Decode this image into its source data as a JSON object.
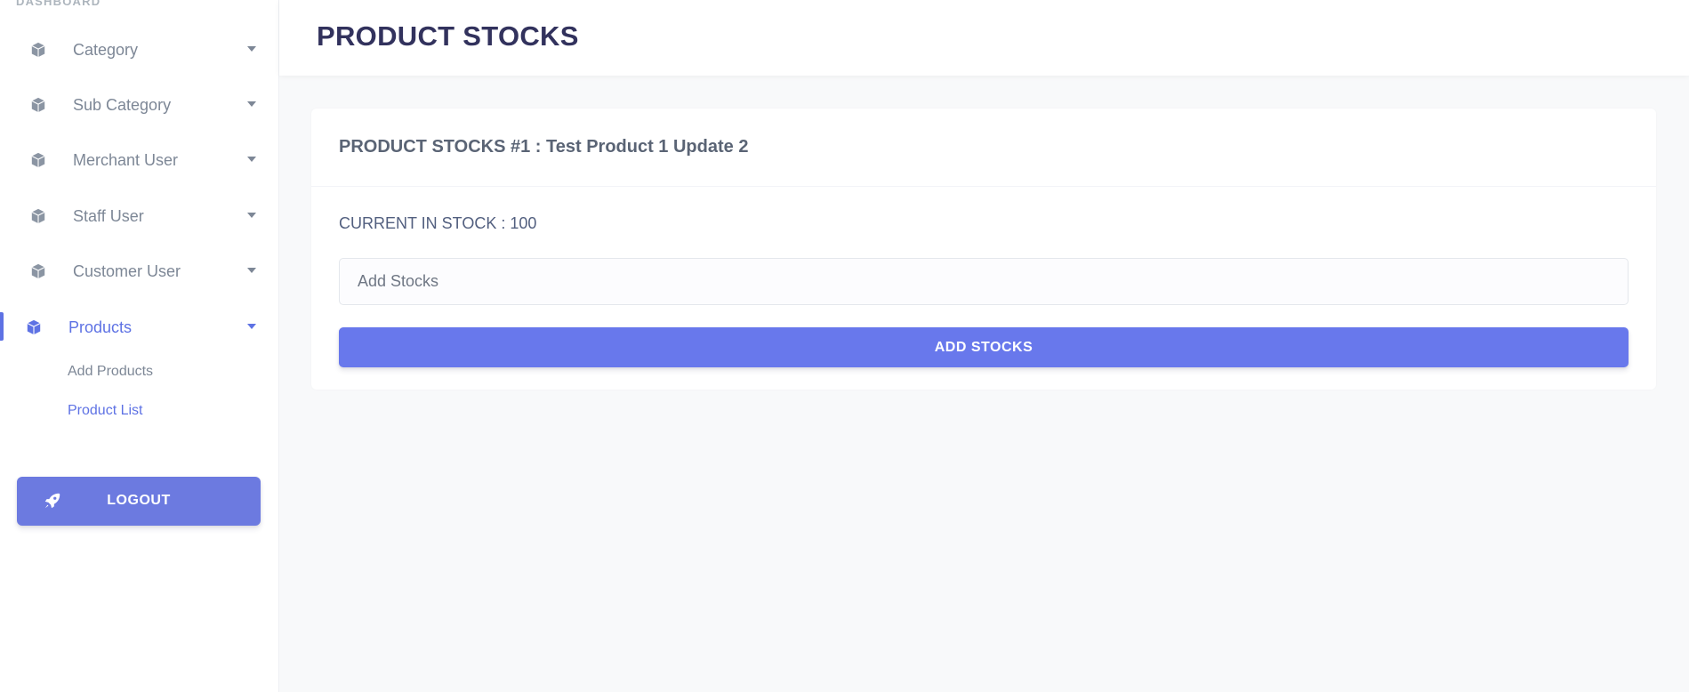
{
  "sidebar": {
    "section_heading": "DASHBOARD",
    "items": [
      {
        "label": "Category",
        "icon": "cube-icon"
      },
      {
        "label": "Sub Category",
        "icon": "cube-icon"
      },
      {
        "label": "Merchant User",
        "icon": "cube-icon"
      },
      {
        "label": "Staff User",
        "icon": "cube-icon"
      },
      {
        "label": "Customer User",
        "icon": "cube-icon"
      },
      {
        "label": "Products",
        "icon": "cube-icon",
        "active": true
      }
    ],
    "products_subitems": [
      {
        "label": "Add Products"
      },
      {
        "label": "Product List",
        "active": true
      }
    ],
    "logout": {
      "label": "LOGOUT",
      "icon": "rocket-icon"
    }
  },
  "header": {
    "title": "PRODUCT STOCKS"
  },
  "card": {
    "title": "PRODUCT STOCKS #1 : Test Product 1 Update 2",
    "current_stock_text": "CURRENT IN STOCK : 100",
    "input_placeholder": "Add Stocks",
    "input_value": "",
    "submit_label": "ADD STOCKS"
  },
  "colors": {
    "accent": "#5e72e4",
    "button": "#6878ec",
    "title": "#32325d",
    "muted": "#7d8796"
  }
}
